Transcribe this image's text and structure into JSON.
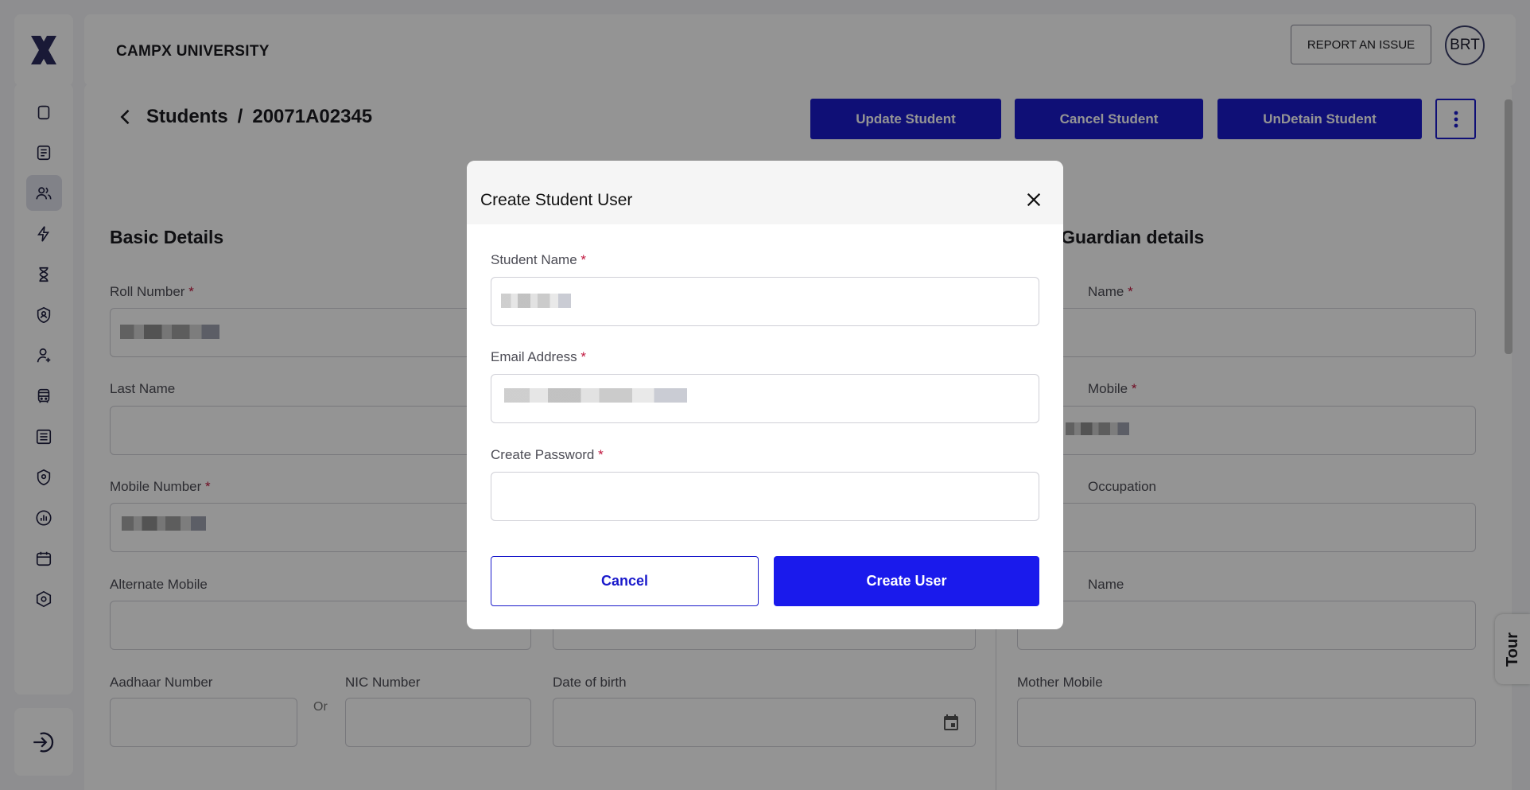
{
  "header": {
    "institution_name": "CAMPX UNIVERSITY",
    "report_button": "REPORT AN ISSUE",
    "avatar_initials": "BRT"
  },
  "sidebar": {
    "items": [
      {
        "icon": "clipboard-icon"
      },
      {
        "icon": "document-icon"
      },
      {
        "icon": "users-icon",
        "active": true
      },
      {
        "icon": "lightning-icon"
      },
      {
        "icon": "hourglass-icon"
      },
      {
        "icon": "shield-user-icon"
      },
      {
        "icon": "user-plus-icon"
      },
      {
        "icon": "bus-icon"
      },
      {
        "icon": "list-icon"
      },
      {
        "icon": "location-shield-icon"
      },
      {
        "icon": "analytics-icon"
      },
      {
        "icon": "calendar-icon"
      },
      {
        "icon": "settings-hexagon-icon"
      }
    ],
    "logout_icon": "logout-icon"
  },
  "page": {
    "breadcrumb_root": "Students",
    "breadcrumb_separator": "/",
    "breadcrumb_current": "20071A02345",
    "actions": {
      "update": "Update Student",
      "cancel": "Cancel Student",
      "undetain": "UnDetain Student"
    }
  },
  "basic_details": {
    "title": "Basic Details",
    "roll_number_label": "Roll Number",
    "last_name_label": "Last Name",
    "mobile_number_label": "Mobile Number",
    "alternate_mobile_label": "Alternate Mobile",
    "aadhaar_label": "Aadhaar Number",
    "or_text": "Or",
    "nic_label": "NIC Number",
    "dob_label": "Date of birth"
  },
  "guardian_details": {
    "title": "nt/Guardian details",
    "name_label": "Name",
    "mobile_label": "Mobile",
    "occupation_label": "Occupation",
    "name2_label": "Name",
    "mother_mobile_label": "Mother Mobile"
  },
  "tour_label": "Tour",
  "modal": {
    "title": "Create Student User",
    "student_name_label": "Student Name",
    "email_label": "Email Address",
    "password_label": "Create Password",
    "required_mark": "*",
    "cancel_button": "Cancel",
    "create_button": "Create User"
  },
  "colors": {
    "primary": "#1a1acb",
    "primary_bright": "#1a1aec",
    "required": "#c0143c"
  }
}
